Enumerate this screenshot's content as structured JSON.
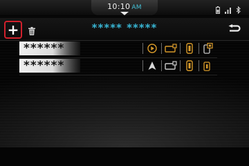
{
  "status_bar": {
    "time": "10:10",
    "ampm": "AM",
    "icons": [
      "battery-icon",
      "signal-icon",
      "bluetooth-icon"
    ]
  },
  "header": {
    "title": "***** *****",
    "add_icon": "+",
    "icons": [
      "plus-icon",
      "trash-icon",
      "back-arrow-icon"
    ]
  },
  "devices": [
    {
      "name": "******",
      "icons": [
        "media-play-icon",
        "car-connection-icon",
        "phone-battery-icon",
        "phone-sync-icon"
      ]
    },
    {
      "name": "******",
      "icons": [
        "navigation-arrow-icon",
        "car-connection-icon",
        "phone-battery-icon",
        "phone-sync-icon"
      ]
    }
  ],
  "colors": {
    "accent": "#38b6d4",
    "highlight_border": "#d2202c",
    "icon_active": "#d89a2a",
    "icon_inactive": "#c8c8c8"
  }
}
